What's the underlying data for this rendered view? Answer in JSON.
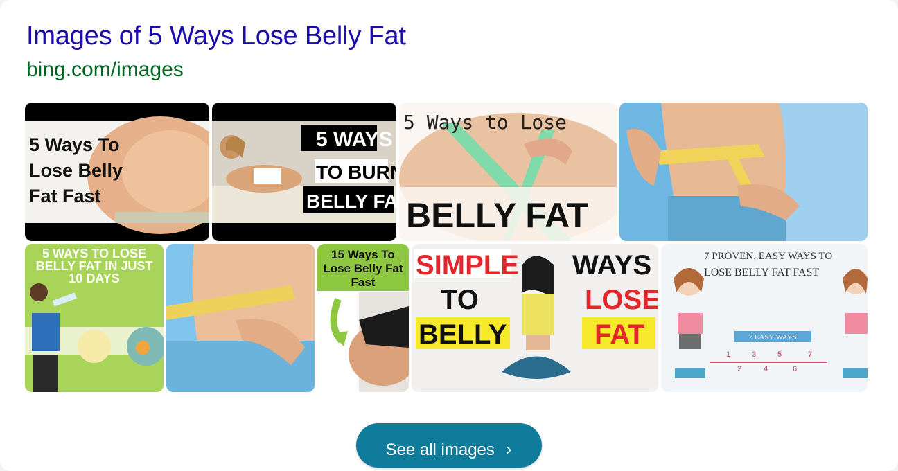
{
  "header": {
    "title": "Images of 5 Ways Lose Belly Fat",
    "source": "bing.com/images"
  },
  "images": [
    {
      "lines": [
        "5 Ways To",
        "Lose Belly",
        "Fat Fast"
      ]
    },
    {
      "lines": [
        "5 WAYS",
        "TO BURN",
        "BELLY FAT"
      ]
    },
    {
      "lines": [
        "5 Ways to Lose",
        "BELLY FAT"
      ]
    },
    {
      "lines": []
    },
    {
      "lines": [
        "5 WAYS TO LOSE",
        "BELLY FAT IN JUST",
        "10 DAYS"
      ]
    },
    {
      "lines": []
    },
    {
      "lines": [
        "15 Ways To",
        "Lose Belly Fat",
        "Fast"
      ]
    },
    {
      "lines": [
        "SIMPLE",
        "WAYS",
        "TO",
        "LOSE",
        "BELLY",
        "FAT"
      ]
    },
    {
      "lines": [
        "7 PROVEN, EASY WAYS TO",
        "LOSE BELLY FAT FAST",
        "7 EASY WAYS",
        "1",
        "2",
        "3",
        "4",
        "5",
        "6",
        "7"
      ]
    }
  ],
  "button": {
    "label": "See all images",
    "icon": "chevron-right-icon"
  },
  "colors": {
    "title": "#1a0dab",
    "source": "#006621",
    "button": "#0f7c9c"
  }
}
